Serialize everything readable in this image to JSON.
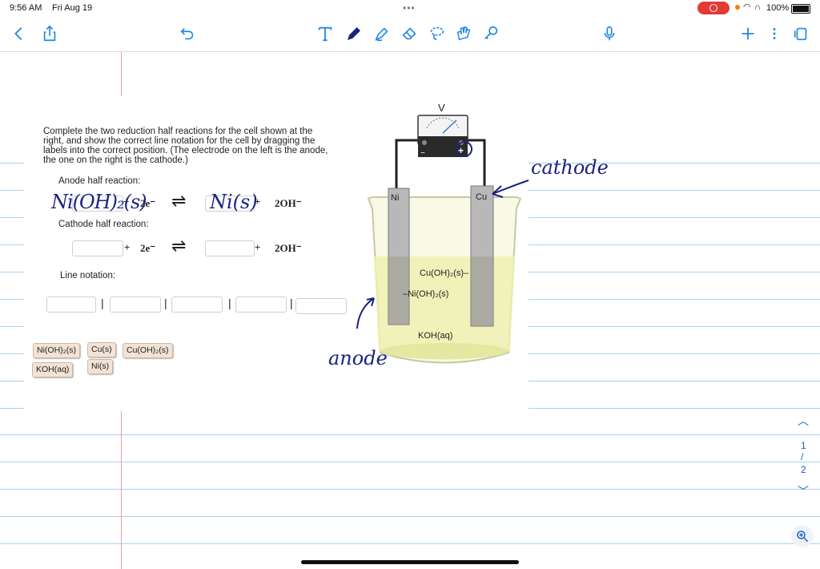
{
  "status_bar": {
    "time": "9:56 AM",
    "date": "Fri Aug 19",
    "battery": "100%"
  },
  "toolbar": {
    "left_icons": [
      "chevron-left-icon",
      "share-icon",
      "undo-icon"
    ],
    "tool_icons": [
      "text-tool-icon",
      "pen-icon",
      "highlighter-icon",
      "eraser-icon",
      "lasso-icon",
      "image-icon",
      "shapes-icon"
    ],
    "right_icons": [
      "microphone-icon",
      "plus-icon",
      "more-icon",
      "pages-icon"
    ]
  },
  "worksheet": {
    "instructions_lines": [
      "Complete the two reduction half reactions for the cell shown at the",
      "right, and show the correct line notation for the cell by dragging the",
      "labels into the correct position. (The electrode on the left is the anode,",
      "the one on the right is the cathode.)"
    ],
    "anode_label": "Anode half reaction:",
    "cathode_label": "Cathode half reaction:",
    "line_notation_label": "Line notation:",
    "electrons": "2e⁻",
    "hydroxide": "2OH⁻",
    "plus": "+",
    "equilibrium": "⇌",
    "separator": "|",
    "labels": [
      "Ni(OH)₂(s)",
      "Cu(s)",
      "Cu(OH)₂(s)",
      "KOH(aq)",
      "Ni(s)"
    ]
  },
  "diagram": {
    "voltmeter": "V",
    "minus": "−",
    "plus": "+",
    "left_electrode": "Ni",
    "right_electrode": "Cu",
    "cu_coating": "Cu(OH)₂(s)–",
    "ni_coating": "–Ni(OH)₂(s)",
    "electrolyte": "KOH(aq)"
  },
  "handwriting": {
    "anode_reactant": "Ni(OH)₂(s)",
    "anode_product": "Ni(s)",
    "cathode": "cathode",
    "anode": "anode"
  },
  "page_nav": {
    "current": "1",
    "slash": "/",
    "total": "2"
  },
  "colors": {
    "rule": "#a9d3ef",
    "margin": "#f29bb0",
    "ink": "#1a237e",
    "recording": "#e53935"
  }
}
